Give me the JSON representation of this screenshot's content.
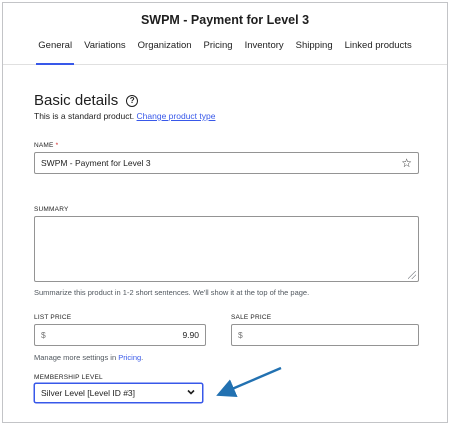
{
  "header": {
    "title": "SWPM - Payment for Level 3",
    "tabs": [
      {
        "label": "General",
        "active": true
      },
      {
        "label": "Variations"
      },
      {
        "label": "Organization"
      },
      {
        "label": "Pricing"
      },
      {
        "label": "Inventory"
      },
      {
        "label": "Shipping"
      },
      {
        "label": "Linked products"
      }
    ]
  },
  "basic_details": {
    "title": "Basic details",
    "help_icon": "?",
    "standard_text": "This is a standard product.",
    "change_type_link": "Change product type"
  },
  "name_field": {
    "label": "NAME",
    "required_mark": "*",
    "value": "SWPM - Payment for Level 3",
    "icon": "star-icon"
  },
  "summary_field": {
    "label": "SUMMARY",
    "value": "",
    "help": "Summarize this product in 1-2 short sentences. We'll show it at the top of the page."
  },
  "list_price": {
    "label": "LIST PRICE",
    "currency": "$",
    "value": "9.90"
  },
  "sale_price": {
    "label": "SALE PRICE",
    "currency": "$",
    "value": ""
  },
  "manage": {
    "text": "Manage more settings in",
    "link": "Pricing",
    "suffix": "."
  },
  "membership": {
    "label": "MEMBERSHIP LEVEL",
    "selected": "Silver Level [Level ID #3]"
  },
  "colors": {
    "accent": "#3858e9",
    "annotation_arrow": "#2271b1"
  }
}
